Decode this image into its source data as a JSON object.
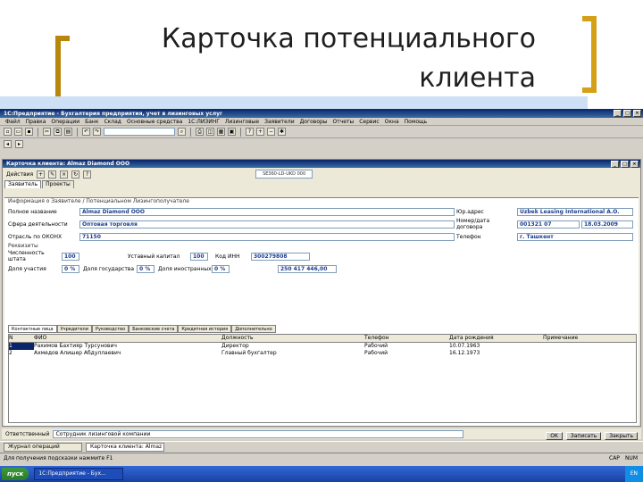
{
  "slide": {
    "title_line1": "Карточка потенциального",
    "title_line2": "клиента"
  },
  "app": {
    "title": "1С:Предприятие - Бухгалтерия предприятия, учет в лизинговых услуг",
    "menu": [
      "Файл",
      "Правка",
      "Операции",
      "Банк",
      "Склад",
      "Основные средства",
      "1С:ЛИЗИНГ",
      "Лизинговые",
      "Заявители",
      "Договоры",
      "Отчеты",
      "Сервис",
      "Окна",
      "Помощь"
    ]
  },
  "doc": {
    "title": "Карточка клиента: Almaz Diamond OOO",
    "actions_label": "Действия",
    "code_field": "SE360-LD-UKD 000",
    "tabs": [
      "Заявитель",
      "Проекты"
    ],
    "section_info": "Информация о Заявителе / Потенциальном Лизингополучателе",
    "fields": {
      "full_name_label": "Полное название",
      "full_name": "Almaz Diamond OOO",
      "activity_label": "Сфера деятельности",
      "activity": "Оптовая торговля",
      "okonh_label": "Отрасль по ОКОНХ",
      "okonh": "71150",
      "inn_label": "Юр.адрес",
      "legal_company": "Uzbek Leasing International A.O.",
      "contract_label": "Номер/дата договора",
      "contract_no": "001321 07",
      "contract_date": "18.03.2009",
      "city_label": "Телефон",
      "city": "г. Ташкент"
    },
    "section_details": "Реквизиты",
    "details": {
      "staff_label": "Численность штата",
      "staff": "100",
      "capital_label": "Уставный капитал",
      "capital": "100",
      "kod_label": "Код ИНН",
      "kod": "300279808",
      "share_label": "Доля участия",
      "share": "0 %",
      "share2_label": "Доля государства",
      "share2": "0 %",
      "share3_label": "Доля иностранных",
      "share3": "0 %",
      "amount": "250 417 446,00"
    },
    "subtabs": [
      "Контактные лица",
      "Учредители",
      "Руководство",
      "Банковские счета",
      "Кредитная история",
      "Дополнительно"
    ],
    "grid": {
      "headers": [
        "N",
        "ФИО",
        "Должность",
        "Телефон",
        "Дата рождения",
        "Примечание"
      ],
      "rows": [
        [
          "1",
          "Рахимов Бахтияр Турсунович",
          "Директор",
          "Рабочий",
          "10.07.1963",
          ""
        ],
        [
          "2",
          "Ахмедов Алишер Абдуллаевич",
          "Главный бухгалтер",
          "Рабочий",
          "16.12.1973",
          ""
        ]
      ]
    },
    "footer_label": "Ответственный",
    "footer_value": "Сотрудник лизинговой компании",
    "buttons": {
      "ok": "OK",
      "save": "Записать",
      "close": "Закрыть"
    }
  },
  "windows": [
    "Журнал операций",
    "Карточка клиента: Almaz Diamond OOO"
  ],
  "status": {
    "left": "Для получения подсказки нажмите F1",
    "cap": "CAP",
    "num": "NUM"
  },
  "taskbar": {
    "start": "пуск",
    "task": "1С:Предприятие - Бух...",
    "clock": "EN"
  },
  "colors": {
    "accent_title": "#0a246a",
    "field_text": "#1c3c8c",
    "bracket": "#b8860b"
  }
}
